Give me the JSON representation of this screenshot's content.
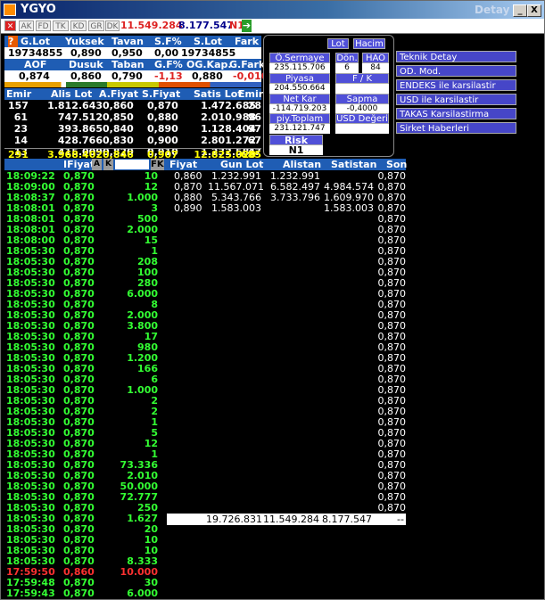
{
  "window": {
    "title": "YGYO",
    "detail": "Detay",
    "btn_min": "_",
    "btn_max": "□",
    "btn_close": "X"
  },
  "toolbar": {
    "tabs": [
      "AK",
      "FD",
      "TK",
      "KD",
      "GR",
      "DK"
    ],
    "value1": "11.549.284",
    "value2": "8.177.547",
    "n1": "N1"
  },
  "summary1": {
    "headers": [
      "G.Lot",
      "Yuksek",
      "Tavan",
      "S.F%",
      "S.Lot",
      "Fark"
    ],
    "values": [
      "19734855",
      "0,890",
      "0,950",
      "0,00",
      "19734855",
      ""
    ]
  },
  "summary2": {
    "headers": [
      "AOF",
      "Dusuk",
      "Taban",
      "G.F%",
      "OG.Kap.",
      "G.Fark"
    ],
    "values": [
      "0,874",
      "0,860",
      "0,790",
      "-1,13",
      "0,880",
      "-0,010"
    ]
  },
  "depth": {
    "headers": [
      "Emir",
      "Alis Lot",
      "A.Fiyat",
      "S.Fiyat",
      "Satis Lot",
      "Emir"
    ],
    "rows": [
      [
        "157",
        "1.812.643",
        "0,860",
        "0,870",
        "1.472.685",
        "28"
      ],
      [
        "61",
        "747.512",
        "0,850",
        "0,880",
        "2.010.988",
        "96"
      ],
      [
        "23",
        "393.865",
        "0,840",
        "0,890",
        "1.128.404",
        "97"
      ],
      [
        "14",
        "428.766",
        "0,830",
        "0,900",
        "2.801.272",
        "67"
      ],
      [
        "13",
        "415.009",
        "0,820",
        "0,910",
        "1.232.581",
        "47"
      ]
    ],
    "total": [
      "291",
      "3.968.402",
      "0,846",
      "0,907",
      "12.825.020",
      "685"
    ]
  },
  "info": {
    "btn_lot": "Lot",
    "btn_hacim": "Hacim",
    "sermaye_label": "Ö.Sermaye",
    "sermaye_value": "235.115.706",
    "don_label": "Dön.",
    "don_value": "6",
    "hao_label": "HAO",
    "hao_value": "84",
    "piyasa_label": "Piyasa Değeri",
    "piyasa_value": "204.550.664",
    "fk_label": "F / K",
    "fk_value": "",
    "netkar_label": "Net Kar",
    "netkar_value": "-114.719.203",
    "sapma_label": "Sapma",
    "sapma_value": "-0,4000",
    "piy_label": "piy.Toplam Lot",
    "piy_value": "231.121.747",
    "usd_label": "USD Değeri",
    "usd_value": "",
    "risk_label": "Risk Kodu",
    "risk_value": "N1"
  },
  "links": [
    "Teknik Detay",
    "OD. Mod.",
    "ENDEKS ile karsilastir",
    "USD ile karsilastir",
    "TAKAS Karsilastirma",
    "Sirket Haberleri"
  ],
  "trades": {
    "headers": {
      "time": "",
      "fiyat": "IFiyat",
      "a": "A",
      "k": "K",
      "fk": "FK"
    },
    "rows": [
      [
        "18:09:22",
        "0,870",
        "10",
        "g"
      ],
      [
        "18:09:00",
        "0,870",
        "12",
        "g"
      ],
      [
        "18:08:37",
        "0,870",
        "1.000",
        "g"
      ],
      [
        "18:08:01",
        "0,870",
        "3",
        "g"
      ],
      [
        "18:08:01",
        "0,870",
        "500",
        "g"
      ],
      [
        "18:08:01",
        "0,870",
        "2.000",
        "g"
      ],
      [
        "18:08:00",
        "0,870",
        "15",
        "g"
      ],
      [
        "18:05:30",
        "0,870",
        "1",
        "g"
      ],
      [
        "18:05:30",
        "0,870",
        "208",
        "g"
      ],
      [
        "18:05:30",
        "0,870",
        "100",
        "g"
      ],
      [
        "18:05:30",
        "0,870",
        "280",
        "g"
      ],
      [
        "18:05:30",
        "0,870",
        "6.000",
        "g"
      ],
      [
        "18:05:30",
        "0,870",
        "8",
        "g"
      ],
      [
        "18:05:30",
        "0,870",
        "2.000",
        "g"
      ],
      [
        "18:05:30",
        "0,870",
        "3.800",
        "g"
      ],
      [
        "18:05:30",
        "0,870",
        "17",
        "g"
      ],
      [
        "18:05:30",
        "0,870",
        "980",
        "g"
      ],
      [
        "18:05:30",
        "0,870",
        "1.200",
        "g"
      ],
      [
        "18:05:30",
        "0,870",
        "166",
        "g"
      ],
      [
        "18:05:30",
        "0,870",
        "6",
        "g"
      ],
      [
        "18:05:30",
        "0,870",
        "1.000",
        "g"
      ],
      [
        "18:05:30",
        "0,870",
        "2",
        "g"
      ],
      [
        "18:05:30",
        "0,870",
        "2",
        "g"
      ],
      [
        "18:05:30",
        "0,870",
        "1",
        "g"
      ],
      [
        "18:05:30",
        "0,870",
        "5",
        "g"
      ],
      [
        "18:05:30",
        "0,870",
        "12",
        "g"
      ],
      [
        "18:05:30",
        "0,870",
        "1",
        "g"
      ],
      [
        "18:05:30",
        "0,870",
        "73.336",
        "g"
      ],
      [
        "18:05:30",
        "0,870",
        "2.010",
        "g"
      ],
      [
        "18:05:30",
        "0,870",
        "50.000",
        "g"
      ],
      [
        "18:05:30",
        "0,870",
        "72.777",
        "g"
      ],
      [
        "18:05:30",
        "0,870",
        "250",
        "g"
      ],
      [
        "18:05:30",
        "0,870",
        "1.627",
        "g"
      ],
      [
        "18:05:30",
        "0,870",
        "20",
        "g"
      ],
      [
        "18:05:30",
        "0,870",
        "10",
        "g"
      ],
      [
        "18:05:30",
        "0,870",
        "10",
        "g"
      ],
      [
        "18:05:30",
        "0,870",
        "8.333",
        "g"
      ],
      [
        "17:59:50",
        "0,860",
        "10.000",
        "r"
      ],
      [
        "17:59:48",
        "0,870",
        "30",
        "g"
      ],
      [
        "17:59:43",
        "0,870",
        "6.000",
        "g"
      ]
    ]
  },
  "price_table": {
    "headers": [
      "Fiyat",
      "Gun Lot",
      "Alistan",
      "Satistan",
      "Son"
    ],
    "rows": [
      [
        "0,860",
        "1.232.991",
        "1.232.991",
        ""
      ],
      [
        "0,870",
        "11.567.071",
        "6.582.497",
        "4.984.574"
      ],
      [
        "0,880",
        "5.343.766",
        "3.733.796",
        "1.609.970"
      ],
      [
        "0,890",
        "1.583.003",
        "",
        "1.583.003"
      ]
    ],
    "son": [
      "0,870",
      "0,870",
      "0,870",
      "0,870",
      "0,870",
      "0,870",
      "0,870",
      "0,870",
      "0,870",
      "0,870",
      "0,870",
      "0,870",
      "0,870",
      "0,870",
      "0,870",
      "0,870",
      "0,870",
      "0,870",
      "0,870",
      "0,870",
      "0,870",
      "0,870",
      "0,870",
      "0,870",
      "0,870",
      "0,870",
      "0,870",
      "0,870",
      "0,870",
      "0,870",
      "0,870",
      "0,870"
    ],
    "totals": [
      "19.726.831",
      "11.549.284",
      "8.177.547",
      "--"
    ]
  },
  "colors": {
    "green": "#33ff33",
    "red": "#ff3030",
    "yellow": "#ffff00",
    "header": "#1f5db4"
  }
}
